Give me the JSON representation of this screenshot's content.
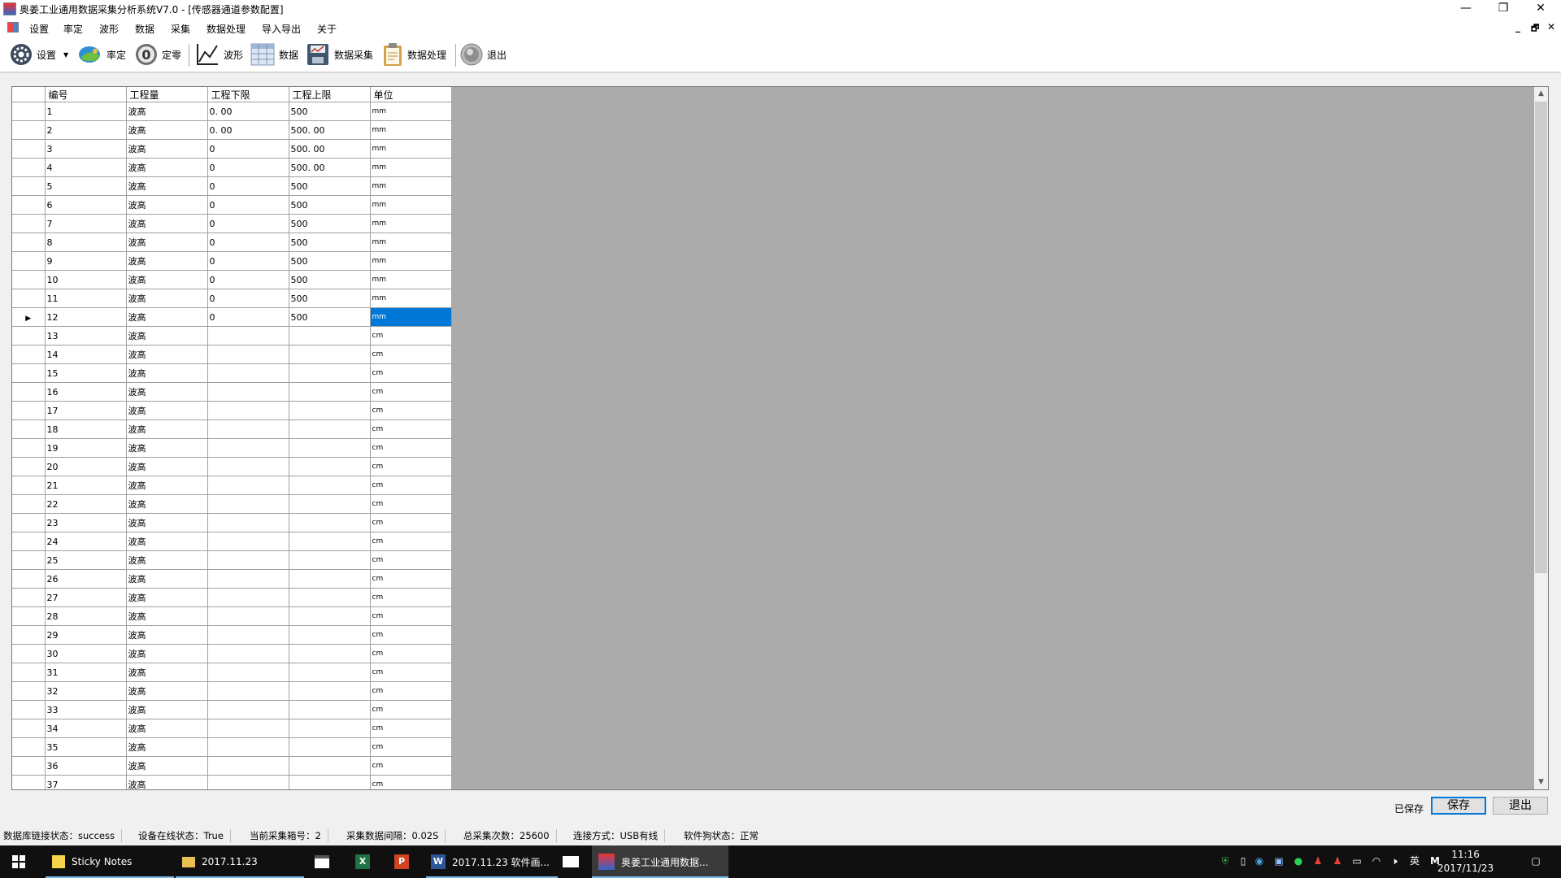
{
  "window": {
    "title": "奥姜工业通用数据采集分析系统V7.0 - [传感器通道参数配置]",
    "minimize": "—",
    "restore": "❐",
    "close": "✕"
  },
  "menu": {
    "items": [
      "设置",
      "率定",
      "波形",
      "数据",
      "采集",
      "数据处理",
      "导入导出",
      "关于"
    ],
    "mdi_min": "_",
    "mdi_restore": "🗗",
    "mdi_close": "✕"
  },
  "toolbar": {
    "settings": "设置",
    "calibrate": "率定",
    "zero": "定零",
    "waveform": "波形",
    "data": "数据",
    "acquire": "数据采集",
    "process": "数据处理",
    "exit": "退出"
  },
  "grid": {
    "columns": [
      "编号",
      "工程量",
      "工程下限",
      "工程上限",
      "单位"
    ],
    "selected_row": 12,
    "rows": [
      [
        "1",
        "波高",
        "0. 00",
        "500",
        "mm"
      ],
      [
        "2",
        "波高",
        "0. 00",
        "500. 00",
        "mm"
      ],
      [
        "3",
        "波高",
        "0",
        "500. 00",
        "mm"
      ],
      [
        "4",
        "波高",
        "0",
        "500. 00",
        "mm"
      ],
      [
        "5",
        "波高",
        "0",
        "500",
        "mm"
      ],
      [
        "6",
        "波高",
        "0",
        "500",
        "mm"
      ],
      [
        "7",
        "波高",
        "0",
        "500",
        "mm"
      ],
      [
        "8",
        "波高",
        "0",
        "500",
        "mm"
      ],
      [
        "9",
        "波高",
        "0",
        "500",
        "mm"
      ],
      [
        "10",
        "波高",
        "0",
        "500",
        "mm"
      ],
      [
        "11",
        "波高",
        "0",
        "500",
        "mm"
      ],
      [
        "12",
        "波高",
        "0",
        "500",
        "mm"
      ],
      [
        "13",
        "波高",
        "",
        "",
        "cm"
      ],
      [
        "14",
        "波高",
        "",
        "",
        "cm"
      ],
      [
        "15",
        "波高",
        "",
        "",
        "cm"
      ],
      [
        "16",
        "波高",
        "",
        "",
        "cm"
      ],
      [
        "17",
        "波高",
        "",
        "",
        "cm"
      ],
      [
        "18",
        "波高",
        "",
        "",
        "cm"
      ],
      [
        "19",
        "波高",
        "",
        "",
        "cm"
      ],
      [
        "20",
        "波高",
        "",
        "",
        "cm"
      ],
      [
        "21",
        "波高",
        "",
        "",
        "cm"
      ],
      [
        "22",
        "波高",
        "",
        "",
        "cm"
      ],
      [
        "23",
        "波高",
        "",
        "",
        "cm"
      ],
      [
        "24",
        "波高",
        "",
        "",
        "cm"
      ],
      [
        "25",
        "波高",
        "",
        "",
        "cm"
      ],
      [
        "26",
        "波高",
        "",
        "",
        "cm"
      ],
      [
        "27",
        "波高",
        "",
        "",
        "cm"
      ],
      [
        "28",
        "波高",
        "",
        "",
        "cm"
      ],
      [
        "29",
        "波高",
        "",
        "",
        "cm"
      ],
      [
        "30",
        "波高",
        "",
        "",
        "cm"
      ],
      [
        "31",
        "波高",
        "",
        "",
        "cm"
      ],
      [
        "32",
        "波高",
        "",
        "",
        "cm"
      ],
      [
        "33",
        "波高",
        "",
        "",
        "cm"
      ],
      [
        "34",
        "波高",
        "",
        "",
        "cm"
      ],
      [
        "35",
        "波高",
        "",
        "",
        "cm"
      ],
      [
        "36",
        "波高",
        "",
        "",
        "cm"
      ],
      [
        "37",
        "波高",
        "",
        "",
        "cm"
      ]
    ]
  },
  "actions": {
    "saved_status": "已保存",
    "save": "保存",
    "exit": "退出"
  },
  "status": {
    "db_link": "数据库链接状态：success",
    "device_online": "设备在线状态：True",
    "current_box": "当前采集箱号：2",
    "interval": "采集数据间隔：0.02S",
    "total_count": "总采集次数：25600",
    "connection": "连接方式：USB有线",
    "dongle": "软件狗状态：正常"
  },
  "taskbar": {
    "sticky_notes": "Sticky Notes",
    "folder": "2017.11.23",
    "word_doc": "2017.11.23 软件画...",
    "app": "奥姜工业通用数据...",
    "ime": "英",
    "time": "11:16",
    "date": "2017/11/23"
  },
  "colors": {
    "selection": "#0078d7",
    "empty_area": "#ababab",
    "taskbar": "#101010"
  }
}
